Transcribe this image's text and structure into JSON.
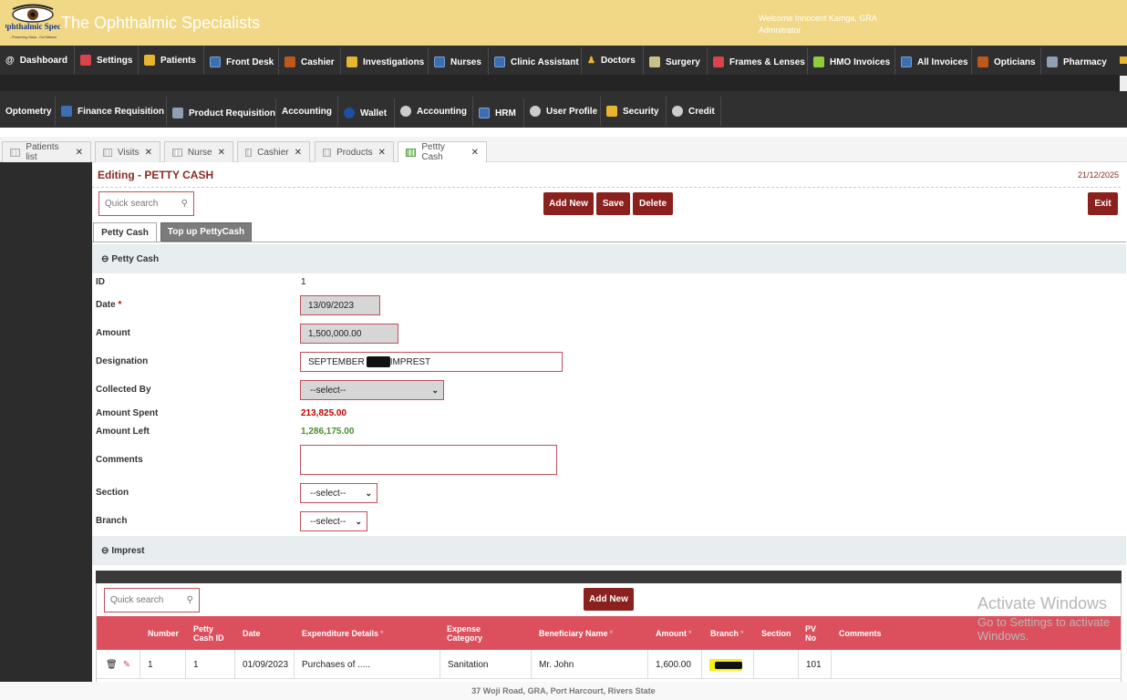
{
  "app": {
    "title": "The Ophthalmic Specialists",
    "logo_text": "The Ophthalmic Specialists",
    "logo_tagline": "...Preserving Vision...Our Mission",
    "welcome": "Welcome Innocent Kamga, GRA",
    "role": "Admnitrator"
  },
  "nav1": [
    {
      "label": "Dashboard",
      "icon": "at-icon"
    },
    {
      "label": "Settings",
      "icon": "settings-icon"
    },
    {
      "label": "Patients",
      "icon": "patients-icon"
    },
    {
      "label": "Front Desk",
      "icon": "front-desk-icon"
    },
    {
      "label": "Cashier",
      "icon": "cashier-icon"
    },
    {
      "label": "Investigations",
      "icon": "investigations-icon"
    },
    {
      "label": "Nurses",
      "icon": "nurses-icon"
    },
    {
      "label": "Clinic Assistant",
      "icon": "clinic-assistant-icon"
    },
    {
      "label": "Doctors",
      "icon": "doctor-icon"
    },
    {
      "label": "Surgery",
      "icon": "surgery-icon"
    },
    {
      "label": "Frames & Lenses",
      "icon": "frames-icon"
    },
    {
      "label": "HMO Invoices",
      "icon": "hmo-icon"
    },
    {
      "label": "All Invoices",
      "icon": "invoices-icon"
    },
    {
      "label": "Opticians",
      "icon": "opticians-icon"
    },
    {
      "label": "Pharmacy",
      "icon": "pharmacy-icon"
    }
  ],
  "nav2": [
    {
      "label": "Optometry",
      "icon": ""
    },
    {
      "label": "Finance Requisition",
      "icon": "finance-icon"
    },
    {
      "label": "Product Requisition",
      "icon": "product-icon"
    },
    {
      "label": "Accounting",
      "icon": ""
    },
    {
      "label": "Wallet",
      "icon": "wallet-icon"
    },
    {
      "label": "Accounting",
      "icon": "accounting-icon"
    },
    {
      "label": "HRM",
      "icon": "hrm-icon"
    },
    {
      "label": "User Profile",
      "icon": "user-profile-icon"
    },
    {
      "label": "Security",
      "icon": "lock-icon"
    },
    {
      "label": "Credit",
      "icon": "info-icon"
    }
  ],
  "tabs": [
    {
      "label": "Patients list"
    },
    {
      "label": "Visits"
    },
    {
      "label": "Nurse"
    },
    {
      "label": "Cashier"
    },
    {
      "label": "Products"
    },
    {
      "label": "Pettty Cash"
    }
  ],
  "page": {
    "title": "Editing - PETTY CASH",
    "date": "21/12/2025"
  },
  "toolbar": {
    "search_placeholder": "Quick search",
    "add_new": "Add New",
    "save": "Save",
    "delete": "Delete",
    "exit": "Exit"
  },
  "form_tabs": {
    "tab1": "Petty Cash",
    "tab2": "Top up PettyCash"
  },
  "section1": {
    "title": "Petty Cash"
  },
  "fields": {
    "id_label": "ID",
    "id_value": "1",
    "date_label": "Date",
    "date_value": "13/09/2023",
    "amount_label": "Amount",
    "amount_value": "1,500,000.00",
    "designation_label": "Designation",
    "designation_prefix": "SEPTEMBER",
    "designation_suffix": "IMPREST",
    "collected_by_label": "Collected By",
    "collected_by_value": "--select--",
    "amount_spent_label": "Amount Spent",
    "amount_spent_value": "213,825.00",
    "amount_left_label": "Amount Left",
    "amount_left_value": "1,286,175.00",
    "comments_label": "Comments",
    "section_label": "Section",
    "section_value": "--select--",
    "branch_label": "Branch",
    "branch_value": "--select--"
  },
  "section2": {
    "title": "Imprest"
  },
  "grid": {
    "search_placeholder": "Quick search",
    "add_new": "Add New",
    "headers": [
      "Number",
      "Petty Cash ID",
      "Date",
      "Expenditure Details",
      "Expense Category",
      "Beneficiary Name",
      "Amount",
      "Branch",
      "Section",
      "PV No",
      "Comments"
    ],
    "rows": [
      {
        "number": "1",
        "petty_cash_id": "1",
        "date": "01/09/2023",
        "details": "Purchases of .....",
        "category": "Sanitation",
        "beneficiary": "Mr. John",
        "amount": "1,600.00",
        "section": "",
        "pv_no": "101",
        "comments": ""
      }
    ]
  },
  "footer": {
    "address": "37 Woji Road, GRA, Port Harcourt, Rivers State"
  },
  "watermark": {
    "line1": "Activate Windows",
    "line2": "Go to Settings to activate Windows."
  },
  "colors": {
    "header": "#f1d886",
    "nav": "#2f2f2f",
    "accent": "#8b211f",
    "grid_header": "#dc505d",
    "spent": "#c00000",
    "left": "#4a8c2a"
  }
}
